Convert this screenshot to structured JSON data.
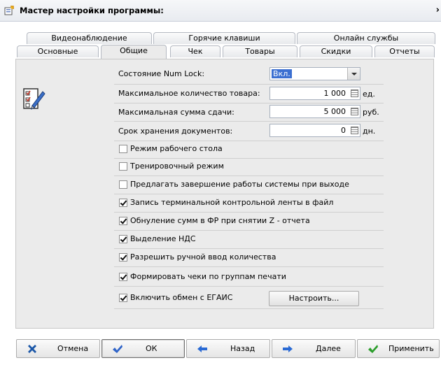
{
  "window": {
    "title": "Мастер настройки программы:",
    "close": "›"
  },
  "tabs": {
    "row1": [
      "Видеонаблюдение",
      "Горячие клавиши",
      "Онлайн службы"
    ],
    "row2": [
      "Основные",
      "Общие",
      "Чек",
      "Товары",
      "Скидки",
      "Отчеты"
    ],
    "active": "Общие"
  },
  "fields": {
    "numlock": {
      "label": "Состояние Num Lock:",
      "value": "Вкл."
    },
    "max_qty": {
      "label": "Максимальное количество товара:",
      "value": "1 000",
      "unit": "ед."
    },
    "max_change": {
      "label": "Максимальная сумма сдачи:",
      "value": "5 000",
      "unit": "руб."
    },
    "doc_storage": {
      "label": "Срок хранения документов:",
      "value": "0",
      "unit": "дн."
    }
  },
  "checkboxes": [
    {
      "label": "Режим рабочего стола",
      "checked": false
    },
    {
      "label": "Тренировочный режим",
      "checked": false
    },
    {
      "label": "Предлагать завершение работы системы при выходе",
      "checked": false
    },
    {
      "label": "Запись терминальной контрольной ленты в файл",
      "checked": true
    },
    {
      "label": "Обнуление сумм в ФР при снятии Z - отчета",
      "checked": true
    },
    {
      "label": "Выделение НДС",
      "checked": true
    },
    {
      "label": "Разрешить ручной ввод количества",
      "checked": true
    },
    {
      "label": "Формировать чеки по группам печати",
      "checked": true
    },
    {
      "label": "Включить обмен с ЕГАИС",
      "checked": true
    }
  ],
  "setup_button": "Настроить...",
  "buttons": {
    "cancel": "Отмена",
    "ok": "ОК",
    "back": "Назад",
    "next": "Далее",
    "apply": "Применить"
  },
  "colors": {
    "cancel_icon": "#1b57a8",
    "ok_icon": "#2e63c8",
    "nav_arrow": "#2a6ad4",
    "apply_icon": "#2a9d2a",
    "selection": "#3b6fd1"
  }
}
